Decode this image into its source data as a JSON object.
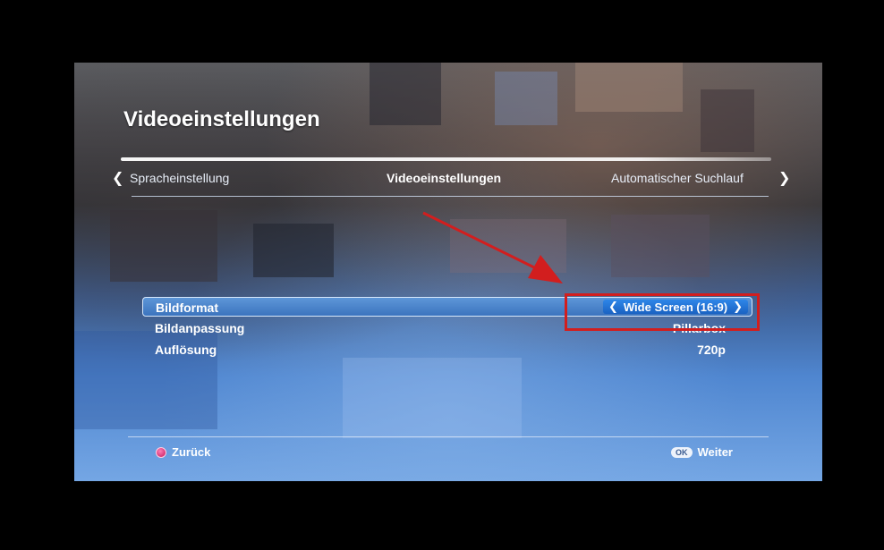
{
  "screen": {
    "title": "Videoeinstellungen"
  },
  "tabs": {
    "left": "Spracheinstellung",
    "center": "Videoeinstellungen",
    "right": "Automatischer Suchlauf",
    "prev_icon": "chevron-left-icon",
    "next_icon": "chevron-right-icon"
  },
  "settings": [
    {
      "label": "Bildformat",
      "value": "Wide Screen (16:9)",
      "selected": true
    },
    {
      "label": "Bildanpassung",
      "value": "Pillarbox",
      "selected": false
    },
    {
      "label": "Auflösung",
      "value": "720p",
      "selected": false
    }
  ],
  "footer": {
    "back_label": "Zurück",
    "next_label": "Weiter",
    "ok_badge": "OK"
  },
  "colors": {
    "accent": "#3c74be",
    "annotation": "#d21e1e"
  }
}
